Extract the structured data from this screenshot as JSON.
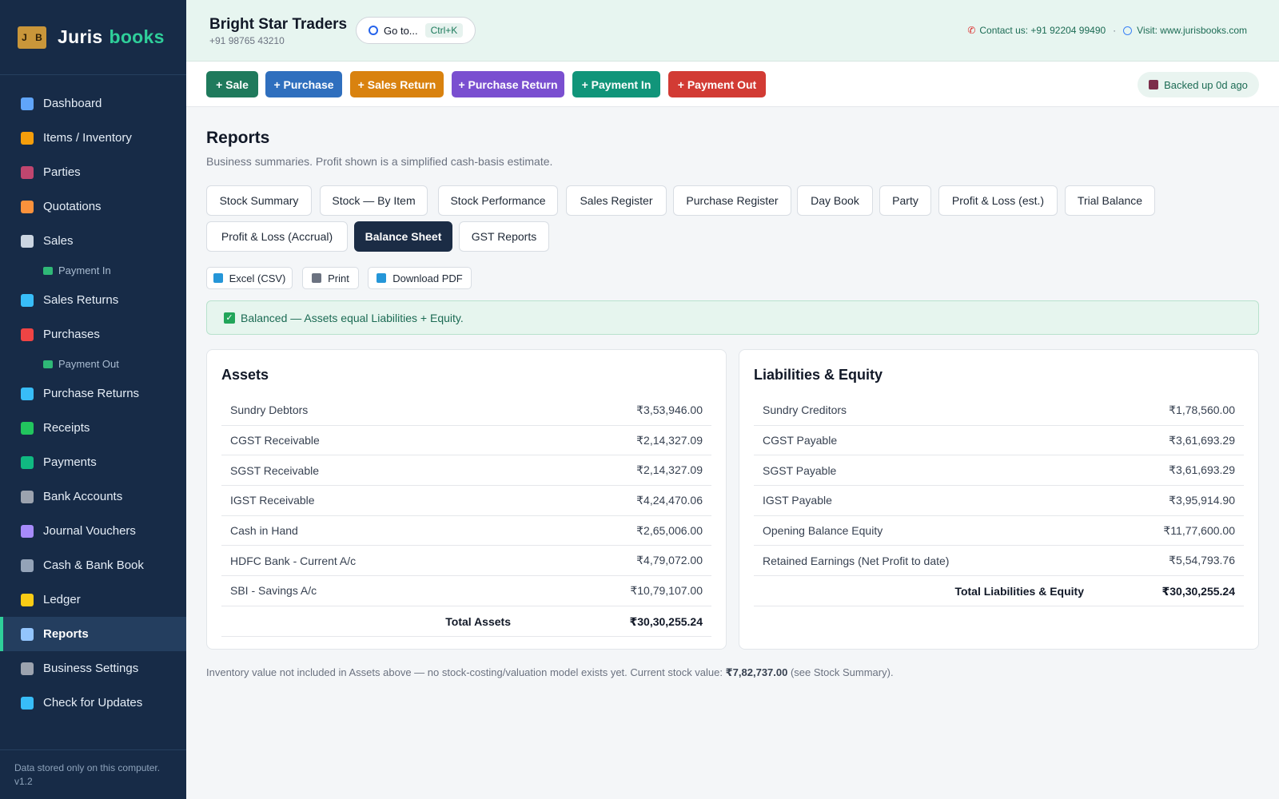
{
  "brand": {
    "logo": [
      "J",
      "B"
    ],
    "word1": "Juris",
    "word2": "books"
  },
  "sidebar": {
    "items": [
      {
        "label": "Dashboard",
        "color": "#60a5fa"
      },
      {
        "label": "Items / Inventory",
        "color": "#f59e0b"
      },
      {
        "label": "Parties",
        "color": "#c0466f"
      },
      {
        "label": "Quotations",
        "color": "#fb923c"
      },
      {
        "label": "Sales",
        "color": "#cbd5e1"
      },
      {
        "label": "Payment In",
        "sub": true
      },
      {
        "label": "Sales Returns",
        "color": "#38bdf8"
      },
      {
        "label": "Purchases",
        "color": "#ef4444"
      },
      {
        "label": "Payment Out",
        "sub": true
      },
      {
        "label": "Purchase Returns",
        "color": "#38bdf8"
      },
      {
        "label": "Receipts",
        "color": "#22c55e"
      },
      {
        "label": "Payments",
        "color": "#10b981"
      },
      {
        "label": "Bank Accounts",
        "color": "#9ca3af"
      },
      {
        "label": "Journal Vouchers",
        "color": "#a78bfa"
      },
      {
        "label": "Cash & Bank Book",
        "color": "#94a3b8"
      },
      {
        "label": "Ledger",
        "color": "#facc15"
      },
      {
        "label": "Reports",
        "color": "#93c5fd",
        "active": true
      },
      {
        "label": "Business Settings",
        "color": "#9ca3af"
      },
      {
        "label": "Check for Updates",
        "color": "#38bdf8"
      }
    ],
    "footer_line1": "Data stored only on this computer.",
    "footer_line2": "v1.2"
  },
  "header": {
    "business_name": "Bright Star Traders",
    "business_phone": "+91 98765 43210",
    "goto_label": "Go to...",
    "goto_shortcut": "Ctrl+K",
    "contact": "Contact us: +91 92204 99490",
    "separator": "·",
    "visit": "Visit: www.jurisbooks.com"
  },
  "toolbar": {
    "buttons": [
      {
        "label": "+ Sale",
        "color": "#1f7a5c"
      },
      {
        "label": "+ Purchase",
        "color": "#2f6fbe"
      },
      {
        "label": "+ Sales Return",
        "color": "#d9820f"
      },
      {
        "label": "+ Purchase Return",
        "color": "#7a4fd0"
      },
      {
        "label": "+ Payment In",
        "color": "#11957a"
      },
      {
        "label": "+ Payment Out",
        "color": "#d23b34"
      }
    ],
    "backup_status": "Backed up 0d ago"
  },
  "reports": {
    "title": "Reports",
    "subtitle": "Business summaries. Profit shown is a simplified cash-basis estimate.",
    "tabs": [
      "Stock Summary",
      "Stock — By Item",
      "Stock Performance",
      "Sales Register",
      "Purchase Register",
      "Day Book",
      "Party",
      "Profit & Loss (est.)",
      "Trial Balance",
      "Profit & Loss (Accrual)",
      "Balance Sheet",
      "GST Reports"
    ],
    "active_tab": "Balance Sheet",
    "exports": [
      "Excel (CSV)",
      "Print",
      "Download PDF"
    ],
    "balanced_message": "Balanced — Assets equal Liabilities + Equity.",
    "assets": {
      "title": "Assets",
      "rows": [
        {
          "label": "Sundry Debtors",
          "amount": "₹3,53,946.00"
        },
        {
          "label": "CGST Receivable",
          "amount": "₹2,14,327.09"
        },
        {
          "label": "SGST Receivable",
          "amount": "₹2,14,327.09"
        },
        {
          "label": "IGST Receivable",
          "amount": "₹4,24,470.06"
        },
        {
          "label": "Cash in Hand",
          "amount": "₹2,65,006.00"
        },
        {
          "label": "HDFC Bank - Current A/c",
          "amount": "₹4,79,072.00"
        },
        {
          "label": "SBI - Savings A/c",
          "amount": "₹10,79,107.00"
        }
      ],
      "total_label": "Total Assets",
      "total_amount": "₹30,30,255.24"
    },
    "liabilities": {
      "title": "Liabilities & Equity",
      "rows": [
        {
          "label": "Sundry Creditors",
          "amount": "₹1,78,560.00"
        },
        {
          "label": "CGST Payable",
          "amount": "₹3,61,693.29"
        },
        {
          "label": "SGST Payable",
          "amount": "₹3,61,693.29"
        },
        {
          "label": "IGST Payable",
          "amount": "₹3,95,914.90"
        },
        {
          "label": "Opening Balance Equity",
          "amount": "₹11,77,600.00"
        },
        {
          "label": "Retained Earnings (Net Profit to date)",
          "amount": "₹5,54,793.76"
        }
      ],
      "total_label": "Total Liabilities & Equity",
      "total_amount": "₹30,30,255.24"
    },
    "note_prefix": "Inventory value not included in Assets above — no stock-costing/valuation model exists yet. Current stock value: ",
    "note_value": "₹7,82,737.00",
    "note_suffix": " (see Stock Summary)."
  }
}
